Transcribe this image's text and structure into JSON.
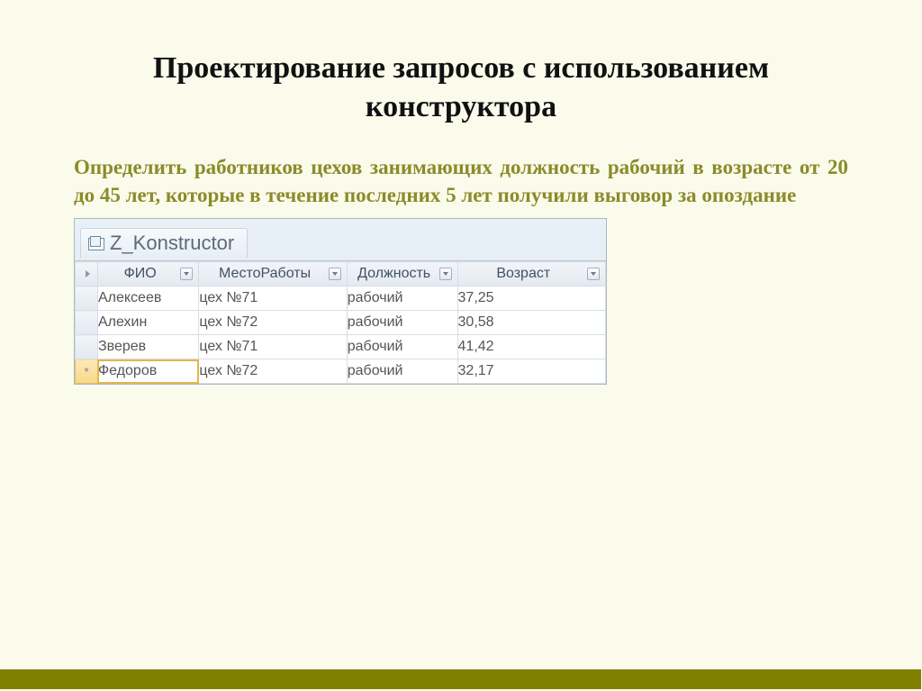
{
  "title": "Проектирование запросов с использованием конструктора",
  "task": "Определить работников цехов занимающих должность рабочий в возрасте от 20 до 45 лет, которые в течение последних 5 лет получили выговор за опоздание",
  "tab_name": "Z_Konstructor",
  "columns": {
    "fio": "ФИО",
    "place": "МестоРаботы",
    "position": "Должность",
    "age": "Возраст"
  },
  "rows": [
    {
      "fio": "Алексеев",
      "place": "цех №71",
      "position": "рабочий",
      "age": "37,25"
    },
    {
      "fio": "Алехин",
      "place": "цех №72",
      "position": "рабочий",
      "age": "30,58"
    },
    {
      "fio": "Зверев",
      "place": "цех №71",
      "position": "рабочий",
      "age": "41,42"
    },
    {
      "fio": "Федоров",
      "place": "цех №72",
      "position": "рабочий",
      "age": "32,17"
    }
  ],
  "selected_row_marker": "*"
}
